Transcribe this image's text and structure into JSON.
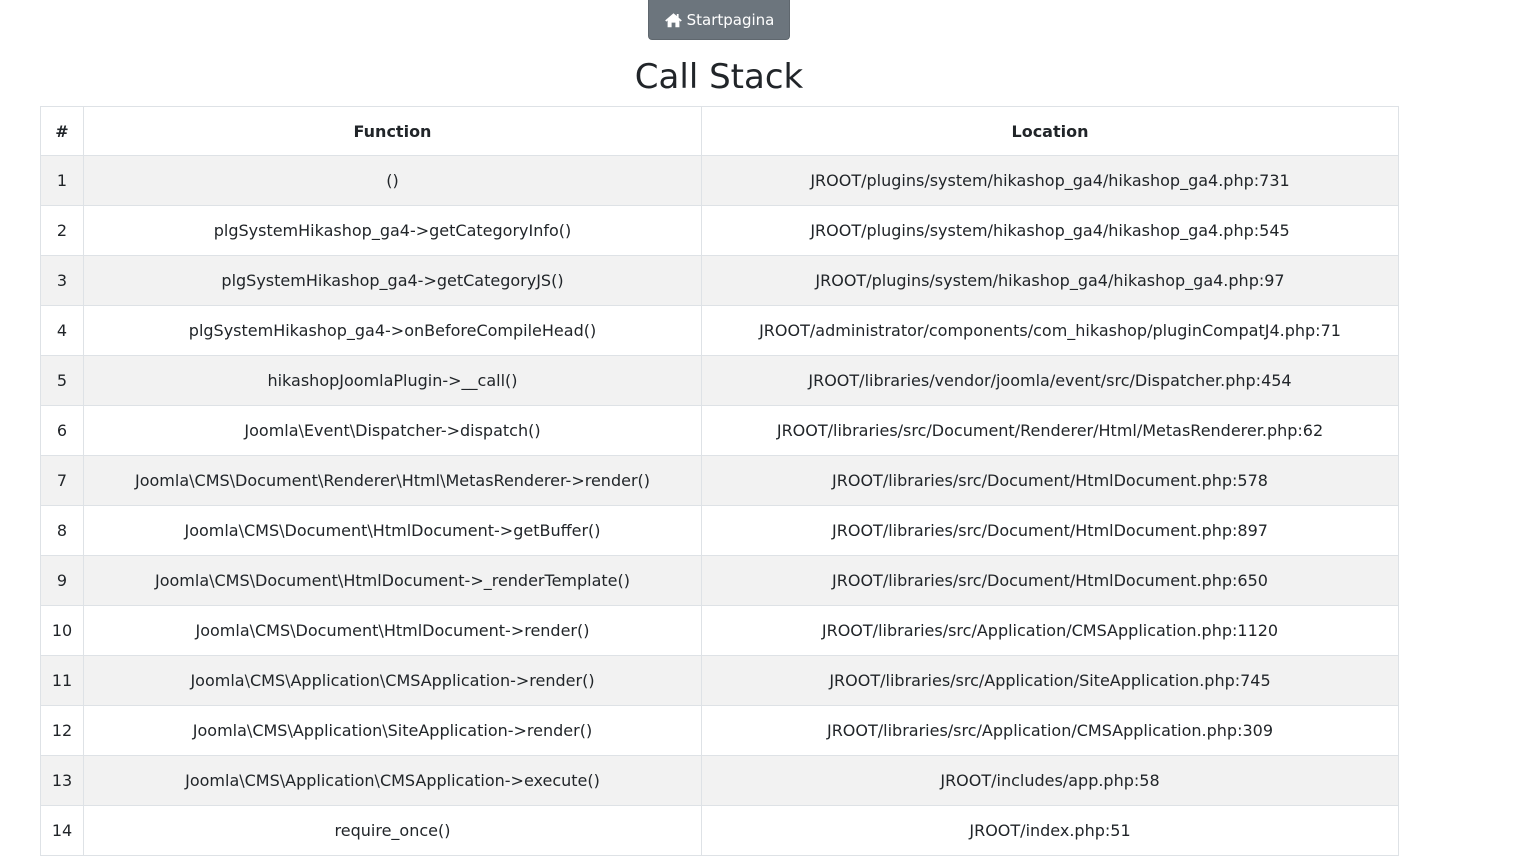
{
  "nav": {
    "home_label": "Startpagina",
    "home_icon": "home-icon"
  },
  "page_title": "Call Stack",
  "table": {
    "headers": {
      "num": "#",
      "function": "Function",
      "location": "Location"
    },
    "rows": [
      {
        "num": "1",
        "function": "()",
        "location": "JROOT/plugins/system/hikashop_ga4/hikashop_ga4.php:731"
      },
      {
        "num": "2",
        "function": "plgSystemHikashop_ga4->getCategoryInfo()",
        "location": "JROOT/plugins/system/hikashop_ga4/hikashop_ga4.php:545"
      },
      {
        "num": "3",
        "function": "plgSystemHikashop_ga4->getCategoryJS()",
        "location": "JROOT/plugins/system/hikashop_ga4/hikashop_ga4.php:97"
      },
      {
        "num": "4",
        "function": "plgSystemHikashop_ga4->onBeforeCompileHead()",
        "location": "JROOT/administrator/components/com_hikashop/pluginCompatJ4.php:71"
      },
      {
        "num": "5",
        "function": "hikashopJoomlaPlugin->__call()",
        "location": "JROOT/libraries/vendor/joomla/event/src/Dispatcher.php:454"
      },
      {
        "num": "6",
        "function": "Joomla\\Event\\Dispatcher->dispatch()",
        "location": "JROOT/libraries/src/Document/Renderer/Html/MetasRenderer.php:62"
      },
      {
        "num": "7",
        "function": "Joomla\\CMS\\Document\\Renderer\\Html\\MetasRenderer->render()",
        "location": "JROOT/libraries/src/Document/HtmlDocument.php:578"
      },
      {
        "num": "8",
        "function": "Joomla\\CMS\\Document\\HtmlDocument->getBuffer()",
        "location": "JROOT/libraries/src/Document/HtmlDocument.php:897"
      },
      {
        "num": "9",
        "function": "Joomla\\CMS\\Document\\HtmlDocument->_renderTemplate()",
        "location": "JROOT/libraries/src/Document/HtmlDocument.php:650"
      },
      {
        "num": "10",
        "function": "Joomla\\CMS\\Document\\HtmlDocument->render()",
        "location": "JROOT/libraries/src/Application/CMSApplication.php:1120"
      },
      {
        "num": "11",
        "function": "Joomla\\CMS\\Application\\CMSApplication->render()",
        "location": "JROOT/libraries/src/Application/SiteApplication.php:745"
      },
      {
        "num": "12",
        "function": "Joomla\\CMS\\Application\\SiteApplication->render()",
        "location": "JROOT/libraries/src/Application/CMSApplication.php:309"
      },
      {
        "num": "13",
        "function": "Joomla\\CMS\\Application\\CMSApplication->execute()",
        "location": "JROOT/includes/app.php:58"
      },
      {
        "num": "14",
        "function": "require_once()",
        "location": "JROOT/index.php:51"
      }
    ]
  }
}
